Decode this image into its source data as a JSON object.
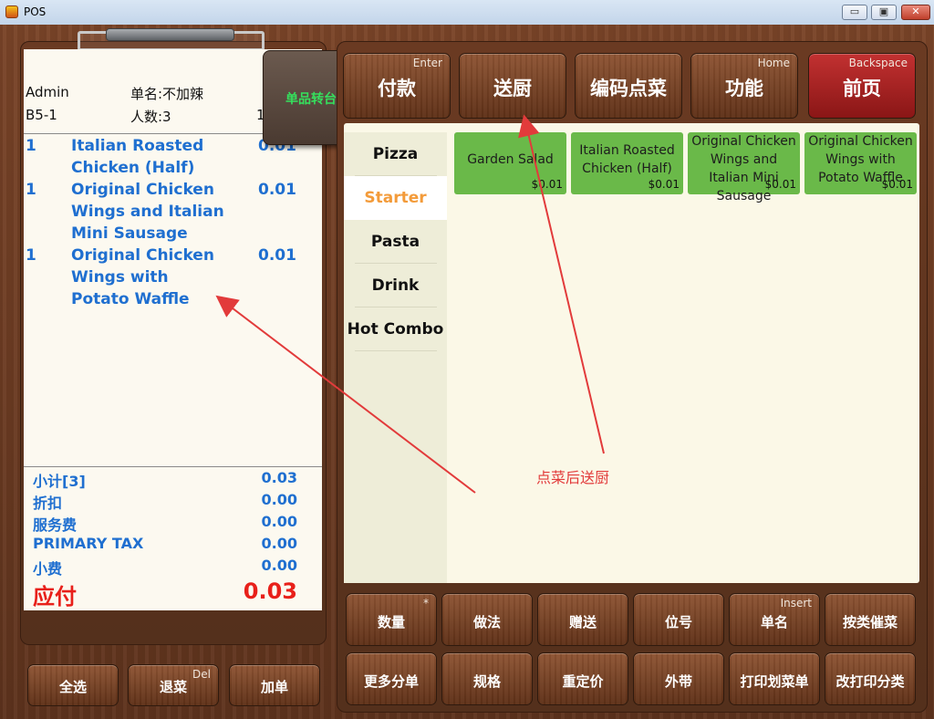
{
  "window": {
    "title": "POS",
    "buttons": {
      "minimize": "▭",
      "maximize": "▣",
      "close": "✕"
    }
  },
  "order": {
    "user": "Admin",
    "note_label": "单名:不加辣",
    "table": "B5-1",
    "guests_label": "人数:3",
    "cut_digit": "1",
    "lines": [
      {
        "qty": "1",
        "name": "Italian Roasted Chicken (Half)",
        "price": "0.01"
      },
      {
        "qty": "1",
        "name": "Original Chicken Wings and Italian Mini Sausage",
        "price": "0.01"
      },
      {
        "qty": "1",
        "name": "Original Chicken Wings with Potato Waffle",
        "price": "0.01"
      }
    ],
    "totals": [
      {
        "label": "小计[3]",
        "value": "0.03"
      },
      {
        "label": "折扣",
        "value": "0.00"
      },
      {
        "label": "服务费",
        "value": "0.00"
      },
      {
        "label": "PRIMARY TAX",
        "value": "0.00"
      },
      {
        "label": "小费",
        "value": "0.00"
      }
    ],
    "due": {
      "label": "应付",
      "value": "0.03"
    }
  },
  "floating_tab": {
    "label": "单品转台"
  },
  "top_buttons": [
    {
      "label": "付款",
      "hint": "Enter"
    },
    {
      "label": "送厨",
      "hint": ""
    },
    {
      "label": "编码点菜",
      "hint": ""
    },
    {
      "label": "功能",
      "hint": "Home"
    },
    {
      "label": "前页",
      "hint": "Backspace"
    }
  ],
  "categories": [
    "Pizza",
    "Starter",
    "Pasta",
    "Drink",
    "Hot Combo"
  ],
  "active_category": "Starter",
  "items": [
    {
      "name": "Garden Salad",
      "price": "$0.01"
    },
    {
      "name": "Italian Roasted Chicken (Half)",
      "price": "$0.01"
    },
    {
      "name": "Original Chicken Wings and Italian Mini Sausage",
      "price": "$0.01"
    },
    {
      "name": "Original Chicken Wings with Potato Waffle",
      "price": "$0.01"
    }
  ],
  "bottom_left_buttons": [
    {
      "label": "全选",
      "hint": ""
    },
    {
      "label": "退菜",
      "hint": "Del"
    },
    {
      "label": "加单",
      "hint": ""
    }
  ],
  "action_row1": [
    {
      "label": "数量",
      "hint": "*"
    },
    {
      "label": "做法",
      "hint": ""
    },
    {
      "label": "赠送",
      "hint": ""
    },
    {
      "label": "位号",
      "hint": ""
    },
    {
      "label": "单名",
      "hint": "Insert"
    },
    {
      "label": "按类催菜",
      "hint": ""
    }
  ],
  "action_row2": [
    {
      "label": "更多分单",
      "hint": ""
    },
    {
      "label": "规格",
      "hint": ""
    },
    {
      "label": "重定价",
      "hint": ""
    },
    {
      "label": "外带",
      "hint": ""
    },
    {
      "label": "打印划菜单",
      "hint": ""
    },
    {
      "label": "改打印分类",
      "hint": ""
    }
  ],
  "annotation": {
    "text": "点菜后送厨",
    "color": "#e23b3b"
  }
}
